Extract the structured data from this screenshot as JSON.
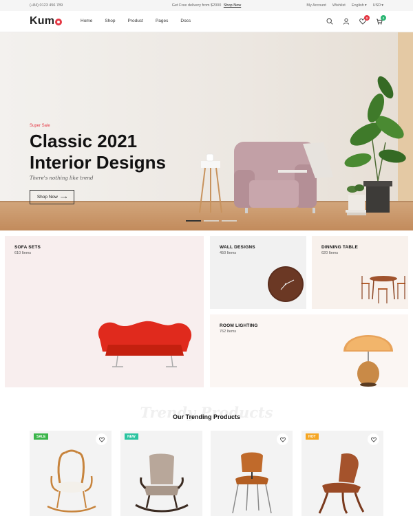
{
  "topbar": {
    "phone": "(+84) 0123 456 789",
    "promo_text": "Get Free delivery from $2000",
    "promo_link": "Shop Now",
    "account": "My Account",
    "wishlist": "Wishlist",
    "language": "English",
    "currency": "USD"
  },
  "header": {
    "logo": "Kum",
    "nav": [
      "Home",
      "Shop",
      "Product",
      "Pages",
      "Docs"
    ],
    "wishlist_count": "0",
    "cart_count": "0",
    "colors": {
      "accent": "#e53945",
      "cart_badge": "#2bb673"
    }
  },
  "hero": {
    "eyebrow": "Super Sale",
    "title_line1": "Classic 2021",
    "title_line2": "Interior Designs",
    "subtitle": "There's nothing like trend",
    "button": "Shop Now",
    "arrow": "⟶",
    "slide_count": 3,
    "active_slide": 1
  },
  "categories": [
    {
      "title": "SOFA SETS",
      "count": "610 Items"
    },
    {
      "title": "WALL DESIGNS",
      "count": "450 Items"
    },
    {
      "title": "DINNING TABLE",
      "count": "620 Items"
    },
    {
      "title": "ROOM LIGHTING",
      "count": "762 Items"
    }
  ],
  "trending": {
    "watermark": "Trendy Products",
    "title": "Our Trending Products",
    "products": [
      {
        "tag": "SALE",
        "tag_color": "#3bb54a",
        "icon": "rocking-chair-icon"
      },
      {
        "tag": "NEW",
        "tag_color": "#2bc4a0",
        "icon": "tufted-rocking-chair-icon"
      },
      {
        "tag": "",
        "tag_color": "",
        "icon": "wood-chair-icon"
      },
      {
        "tag": "HOT",
        "tag_color": "#f5a623",
        "icon": "lounge-chair-icon"
      }
    ]
  }
}
